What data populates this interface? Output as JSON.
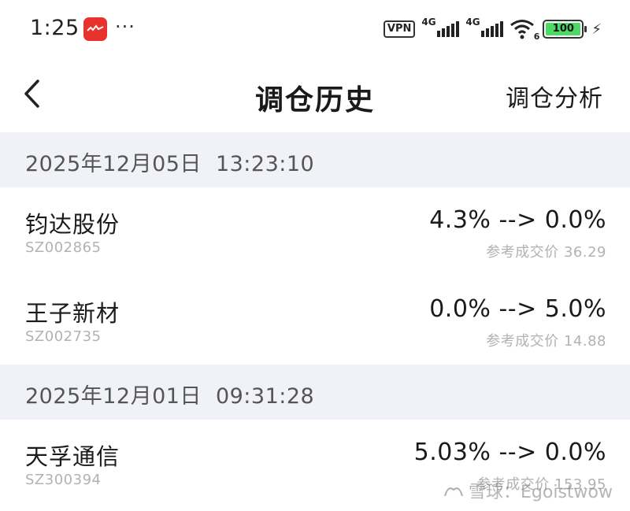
{
  "status_bar": {
    "time": "1:25",
    "more": "···",
    "vpn": "VPN",
    "network1": "4G",
    "network2": "4G",
    "wifi_sub": "6",
    "battery": "100"
  },
  "nav": {
    "title": "调仓历史",
    "analysis": "调仓分析"
  },
  "groups": [
    {
      "date": "2025年12月05日",
      "time": "13:23:10",
      "items": [
        {
          "name": "钧达股份",
          "code": "SZ002865",
          "change": "4.3% --> 0.0%",
          "ref_price": "参考成交价 36.29"
        },
        {
          "name": "王子新材",
          "code": "SZ002735",
          "change": "0.0% --> 5.0%",
          "ref_price": "参考成交价 14.88"
        }
      ]
    },
    {
      "date": "2025年12月01日",
      "time": "09:31:28",
      "items": [
        {
          "name": "天孚通信",
          "code": "SZ300394",
          "change": "5.03% --> 0.0%",
          "ref_price": "参考成交价 153.95"
        }
      ]
    }
  ],
  "watermark": "雪球：Egoistwow",
  "colors": {
    "group_header_bg": "#f1f2f7",
    "app_icon": "#e8322d",
    "battery_fill": "#4cd964"
  }
}
